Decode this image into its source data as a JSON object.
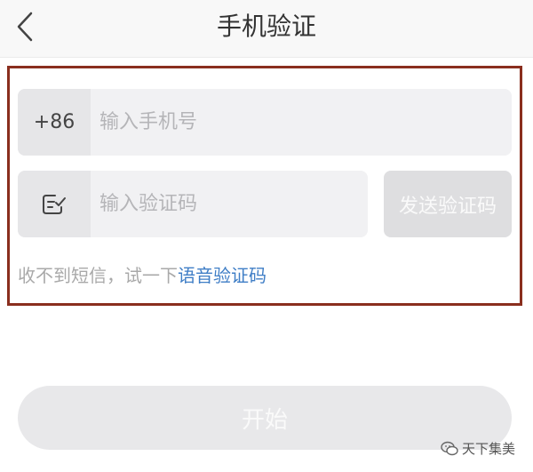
{
  "header": {
    "title": "手机验证"
  },
  "phone": {
    "prefix": "+86",
    "placeholder": "输入手机号"
  },
  "code": {
    "placeholder": "输入验证码",
    "send_label": "发送验证码"
  },
  "hint": {
    "text": "收不到短信，试一下",
    "voice_link": "语音验证码"
  },
  "start_label": "开始",
  "watermark": {
    "text": "天下集美"
  },
  "colors": {
    "highlight_border": "#8a2e1e",
    "link": "#3f7ec6"
  }
}
